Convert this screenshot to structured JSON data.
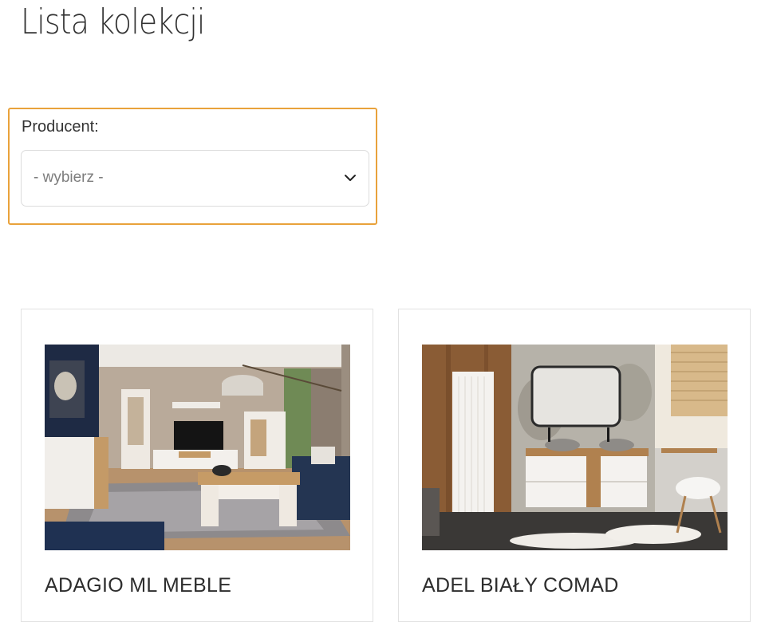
{
  "page": {
    "title": "Lista kolekcji"
  },
  "filter": {
    "label": "Producent:",
    "select_value": "- wybierz -",
    "chevron_icon": "chevron-down-icon",
    "highlight_color": "#e9a23b"
  },
  "collections": [
    {
      "title": "ADAGIO ML MEBLE",
      "image": "living-room-photo"
    },
    {
      "title": "ADEL BIAŁY COMAD",
      "image": "bathroom-photo"
    }
  ]
}
